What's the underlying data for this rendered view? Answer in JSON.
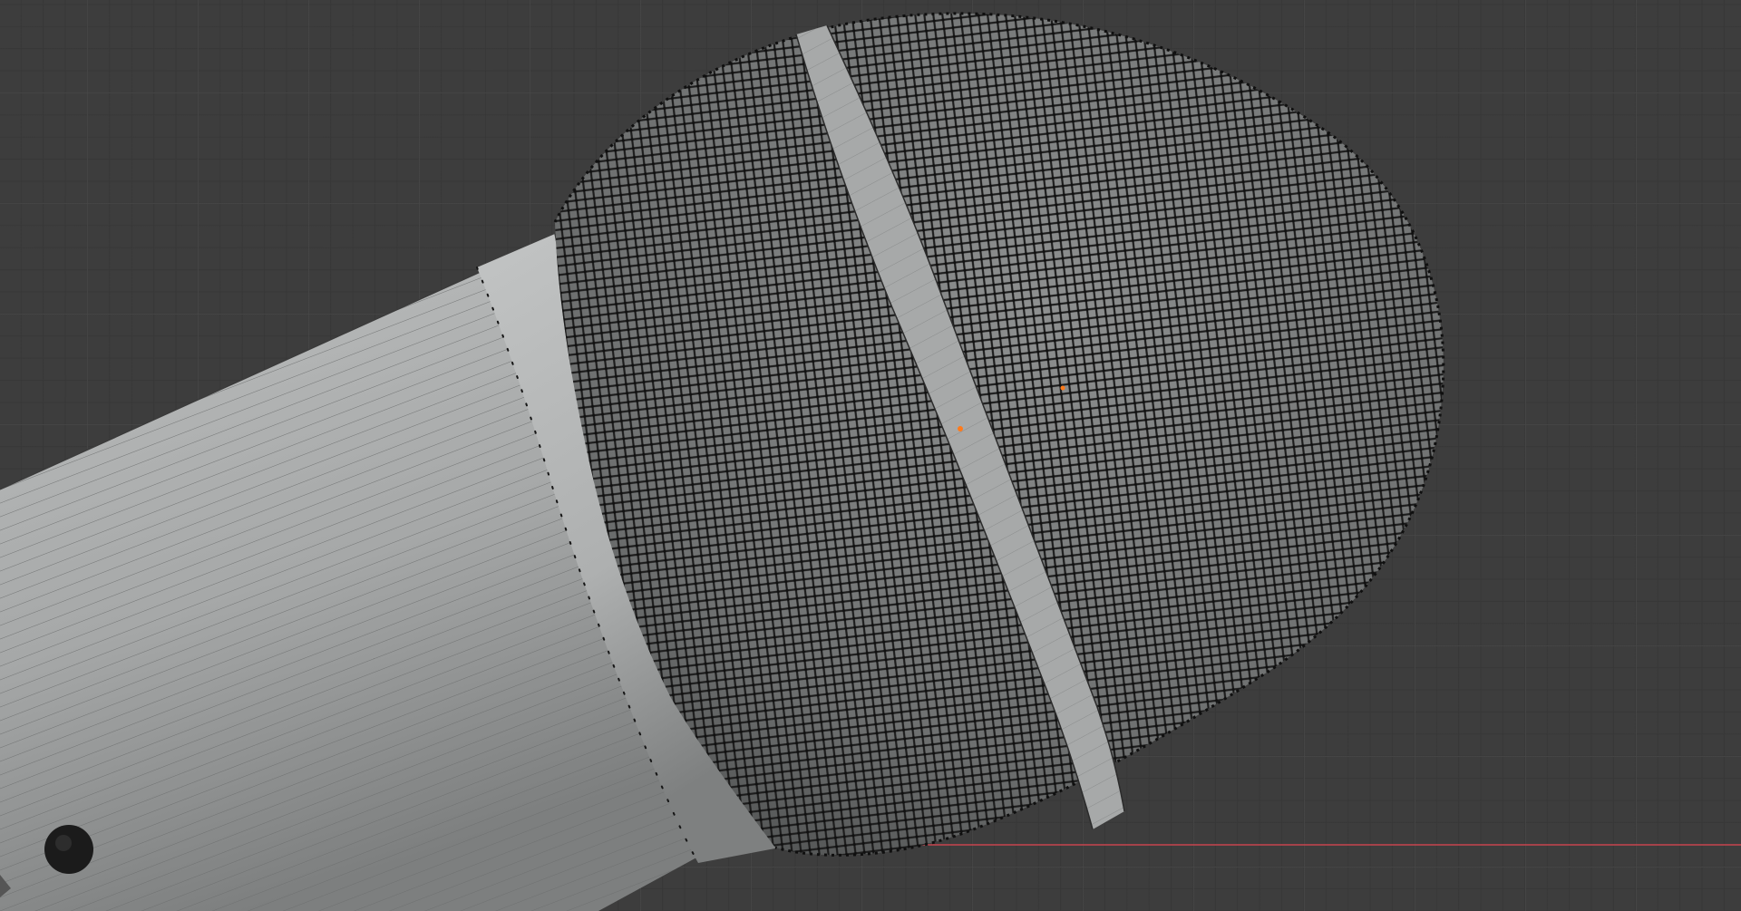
{
  "viewport": {
    "background_color": "#3d3d3d",
    "grid_color": "#464646",
    "x_axis_color": "#c8454e",
    "mesh_body_color": "#a9abab",
    "mesh_shadow_color": "#6b6d6d",
    "wire_color": "#1a1a1a",
    "selected_vertex_color": "#ff7a1a",
    "objects": {
      "handle": "cylinder-handle-mesh",
      "collar": "handle-collar-mesh",
      "grille": "mesh-grille-sphere",
      "band": "grille-band-ring",
      "button": "handle-button"
    }
  }
}
